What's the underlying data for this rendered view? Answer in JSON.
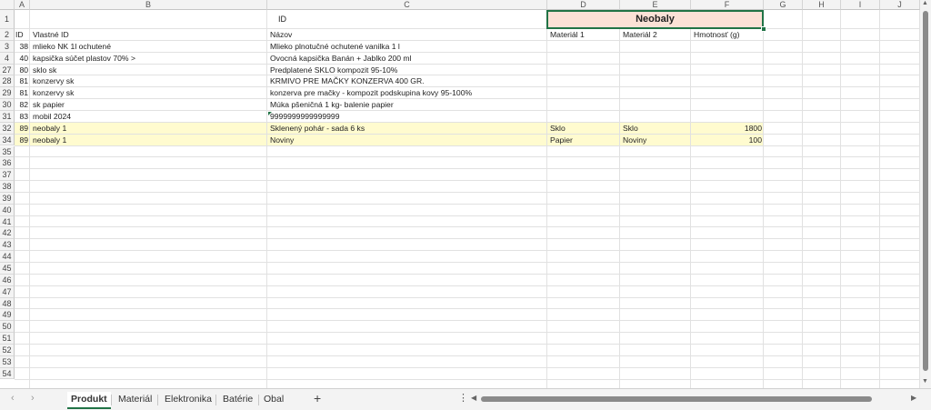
{
  "columns": [
    "A",
    "B",
    "C",
    "D",
    "E",
    "F",
    "G",
    "H",
    "I",
    "J"
  ],
  "header_row1": {
    "c": "ID",
    "def_merged": "Neobaly"
  },
  "header_row2": {
    "a": "ID",
    "b": "Vlastné ID",
    "c": "Názov",
    "d": "Materiál 1",
    "e": "Materiál 2",
    "f": "Hmotnosť (g)"
  },
  "rows": [
    {
      "num": "3",
      "a": "38",
      "b": "mlieko NK 1l ochutené",
      "c": "Mlieko plnotučné ochutené vanilka  1 l",
      "d": "",
      "e": "",
      "f": ""
    },
    {
      "num": "4",
      "a": "40",
      "b": "kapsička súčet plastov 70% >",
      "c": "Ovocná kapsička Banán + Jablko 200 ml",
      "d": "",
      "e": "",
      "f": ""
    },
    {
      "num": "27",
      "a": "80",
      "b": "sklo sk",
      "c": "Predplatené SKLO kompozit 95-10%",
      "d": "",
      "e": "",
      "f": ""
    },
    {
      "num": "28",
      "a": "81",
      "b": "konzervy sk",
      "c": "KRMIVO PRE MAČKY KONZERVA 400 GR.",
      "d": "",
      "e": "",
      "f": ""
    },
    {
      "num": "29",
      "a": "81",
      "b": "konzervy sk",
      "c": "konzerva pre mačky - kompozit podskupina kovy 95-100%",
      "d": "",
      "e": "",
      "f": ""
    },
    {
      "num": "30",
      "a": "82",
      "b": "sk papier",
      "c": "Múka pšeničná 1 kg- balenie papier",
      "d": "",
      "e": "",
      "f": ""
    },
    {
      "num": "31",
      "a": "83",
      "b": "mobil 2024",
      "c": "9999999999999999",
      "d": "",
      "e": "",
      "f": ""
    },
    {
      "num": "32",
      "a": "89",
      "b": "neobaly 1",
      "c": "Sklenený pohár - sada 6 ks",
      "d": "Sklo",
      "e": "Sklo",
      "f": "1800"
    },
    {
      "num": "34",
      "a": "89",
      "b": "neobaly 1",
      "c": "Noviny",
      "d": "Papier",
      "e": "Noviny",
      "f": "100"
    }
  ],
  "empty_rows": [
    "35",
    "36",
    "37",
    "38",
    "39",
    "40",
    "41",
    "42",
    "43",
    "44",
    "45",
    "46",
    "47",
    "48",
    "49",
    "50",
    "51",
    "52",
    "53",
    "54"
  ],
  "tabs": [
    "Produkt",
    "Materiál",
    "Elektronika",
    "Batérie",
    "Obal"
  ],
  "active_tab": "Produkt",
  "colors": {
    "accent": "#217346",
    "highlight": "#fffbcf",
    "neobaly_fill": "#fbe1d6"
  },
  "icons": {
    "prev_sheet": "chevron-left-icon",
    "next_sheet": "chevron-right-icon",
    "add_sheet": "plus-icon",
    "more": "vertical-dots-icon"
  }
}
